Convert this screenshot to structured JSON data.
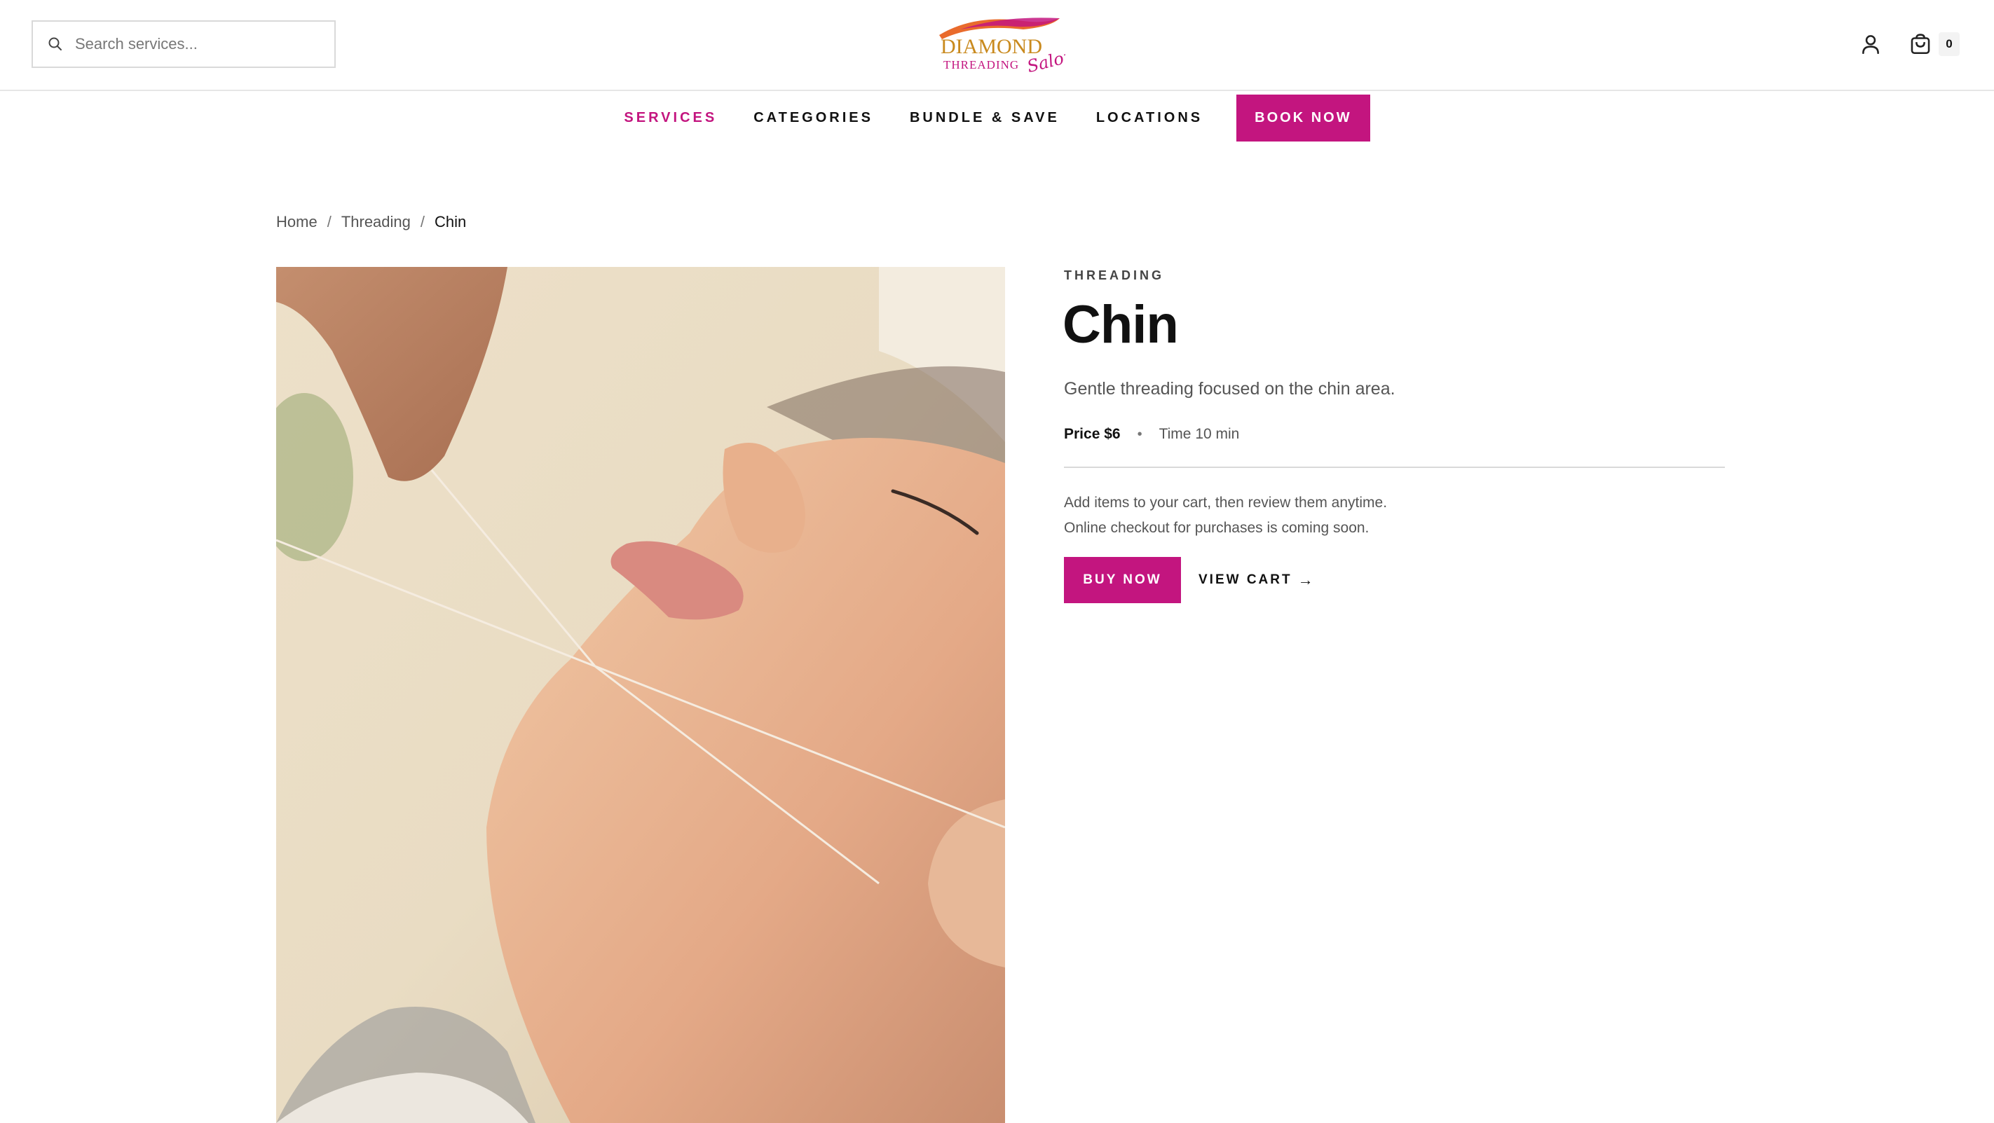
{
  "search": {
    "placeholder": "Search services..."
  },
  "brand": {
    "logo_line1": "DIAMOND",
    "logo_line2": "THREADING",
    "logo_script": "Salon",
    "accent_color": "#c3157f"
  },
  "header_actions": {
    "account_icon": "user-icon",
    "cart_icon": "shopping-bag-icon",
    "cart_count": "0"
  },
  "nav": {
    "items": [
      {
        "label": "SERVICES",
        "active": true
      },
      {
        "label": "CATEGORIES",
        "active": false
      },
      {
        "label": "BUNDLE & SAVE",
        "active": false
      },
      {
        "label": "LOCATIONS",
        "active": false
      }
    ],
    "book_label": "BOOK NOW"
  },
  "breadcrumb": {
    "home": "Home",
    "sep": "/",
    "category": "Threading",
    "current": "Chin"
  },
  "product": {
    "category": "THREADING",
    "title": "Chin",
    "description": "Gentle threading focused on the chin area.",
    "price": "Price $6",
    "dot": "•",
    "time": "Time 10 min",
    "note_line1": "Add items to your cart, then review them anytime.",
    "note_line2": "Online checkout for purchases is coming soon.",
    "buy_label": "BUY NOW",
    "view_cart_label": "VIEW CART",
    "view_cart_arrow": "→",
    "image": "woman-receiving-chin-threading-photo"
  }
}
